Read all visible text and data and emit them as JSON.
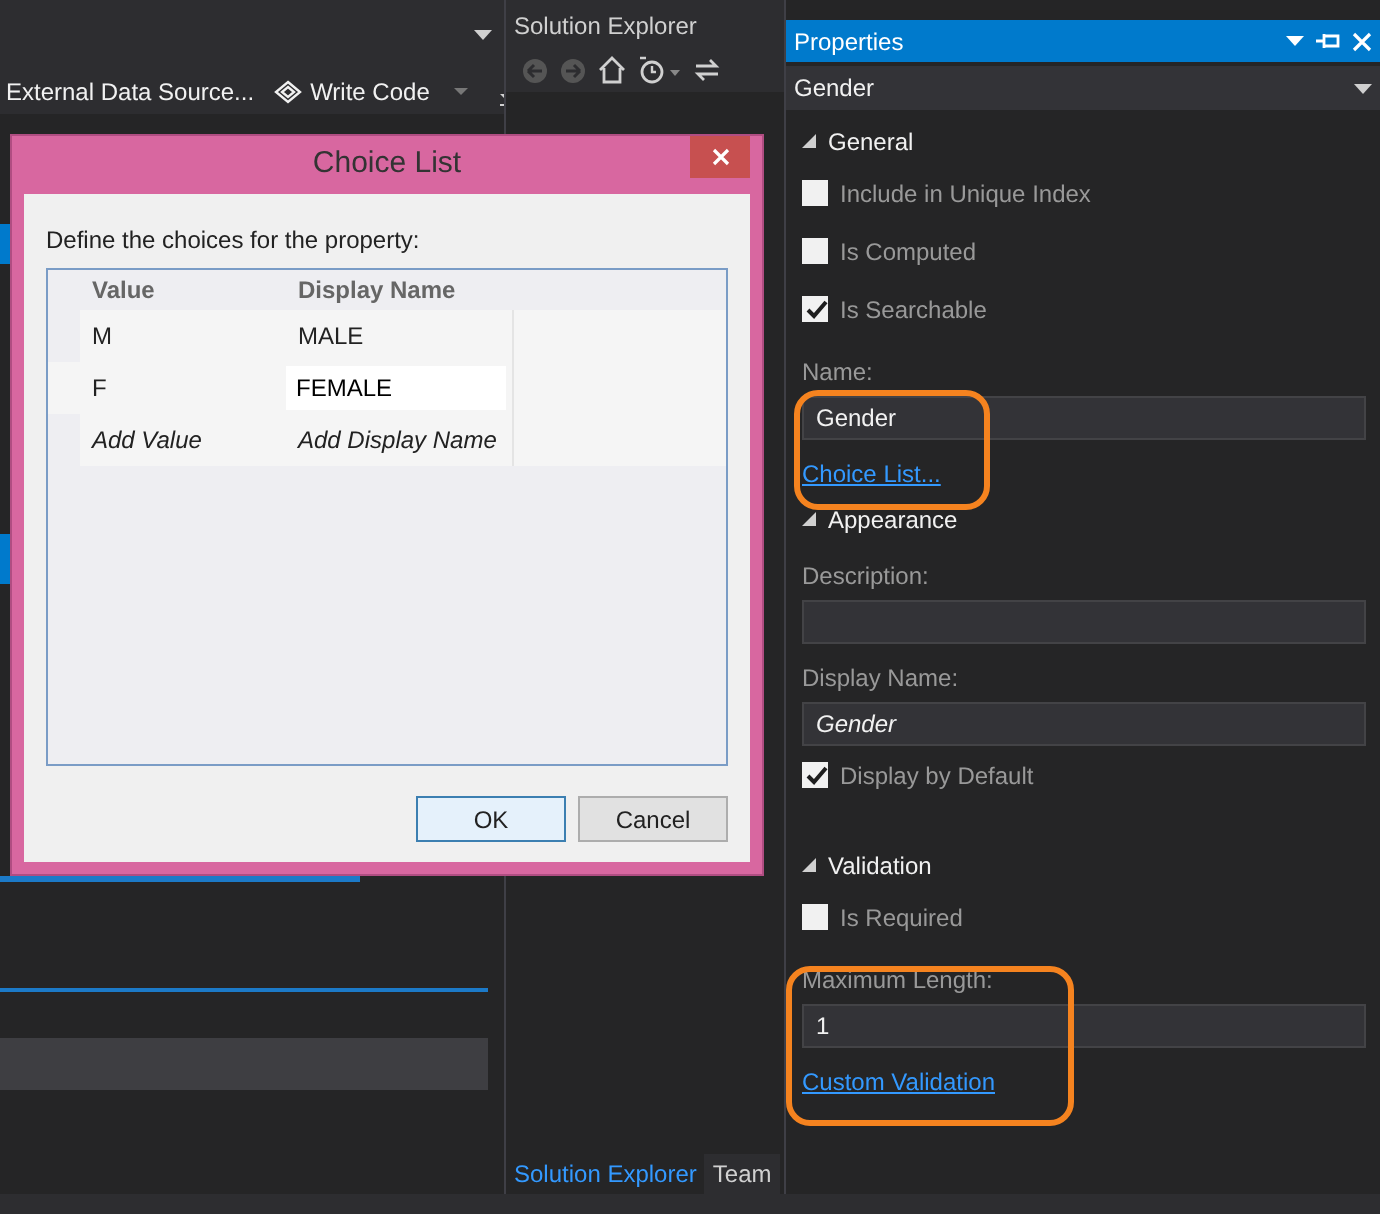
{
  "designer_toolbar": {
    "buttons": [
      {
        "kind": "text",
        "label": "External Data Source..."
      },
      {
        "kind": "code",
        "label": "Write Code"
      }
    ]
  },
  "solution_explorer": {
    "title": "Solution Explorer",
    "tabs": [
      {
        "label": "Solution Explorer",
        "selected": true
      },
      {
        "label": "Team",
        "selected": false
      }
    ]
  },
  "properties": {
    "title": "Properties",
    "object": "Gender",
    "sections": [
      {
        "title": "General",
        "expanded": true,
        "items": [
          {
            "kind": "checkbox",
            "label": "Include in Unique Index",
            "checked": false
          },
          {
            "kind": "checkbox",
            "label": "Is Computed",
            "checked": false
          },
          {
            "kind": "checkbox",
            "label": "Is Searchable",
            "checked": true
          },
          {
            "kind": "field",
            "label": "Name:",
            "value": "Gender"
          },
          {
            "kind": "link",
            "label": "Choice List..."
          }
        ]
      },
      {
        "title": "Appearance",
        "expanded": true,
        "items": [
          {
            "kind": "field",
            "label": "Description:"
          },
          {
            "kind": "field",
            "label": "Display Name:",
            "placeholder": "Gender"
          },
          {
            "kind": "checkbox",
            "label": "Display by Default",
            "checked": true
          }
        ]
      },
      {
        "title": "Validation",
        "expanded": true,
        "items": [
          {
            "kind": "checkbox",
            "label": "Is Required",
            "checked": false
          },
          {
            "kind": "field",
            "label": "Maximum Length:",
            "value": "1"
          },
          {
            "kind": "link",
            "label": "Custom Validation"
          }
        ]
      }
    ]
  },
  "dialog": {
    "title": "Choice List",
    "prompt": "Define the choices for the property:",
    "columns": [
      "Value",
      "Display Name"
    ],
    "rows": [
      {
        "value": "M",
        "display_name": "MALE",
        "editing": false
      },
      {
        "value": "F",
        "display_name": "FEMALE",
        "editing": true
      }
    ],
    "new_row": {
      "value": "Add Value",
      "display_name": "Add Display Name"
    },
    "buttons": [
      {
        "label": "OK",
        "default": true
      },
      {
        "label": "Cancel",
        "default": false
      }
    ]
  }
}
